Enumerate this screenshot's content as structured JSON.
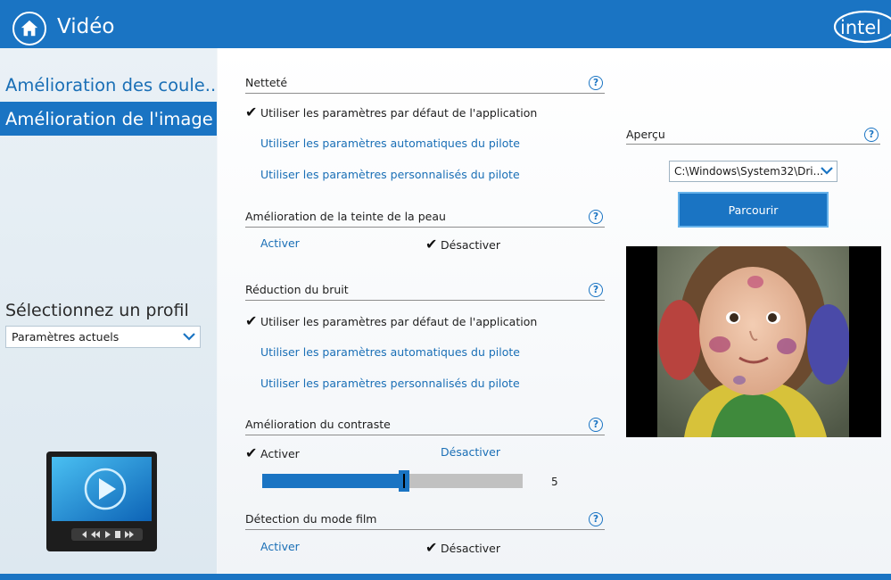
{
  "header": {
    "title": "Vidéo",
    "brand": "intel",
    "accent_color": "#1a74c3"
  },
  "sidebar": {
    "items": [
      {
        "label": "Amélioration des coule...",
        "active": false
      },
      {
        "label": "Amélioration de l'image",
        "active": true
      }
    ],
    "profile_label": "Sélectionnez un profil",
    "profile_value": "Paramètres actuels"
  },
  "sections": {
    "sharpness": {
      "title": "Netteté",
      "options": [
        "Utiliser les paramètres par défaut de l'application",
        "Utiliser les paramètres automatiques du pilote",
        "Utiliser les paramètres personnalisés du pilote"
      ],
      "selected": 0
    },
    "skin_tone": {
      "title": "Amélioration de la teinte de la peau",
      "enable": "Activer",
      "disable": "Désactiver",
      "selected": "disable"
    },
    "noise": {
      "title": "Réduction du bruit",
      "options": [
        "Utiliser les paramètres par défaut de l'application",
        "Utiliser les paramètres automatiques du pilote",
        "Utiliser les paramètres personnalisés du pilote"
      ],
      "selected": 0
    },
    "contrast": {
      "title": "Amélioration du contraste",
      "enable": "Activer",
      "disable": "Désactiver",
      "selected": "enable",
      "slider_value": "5",
      "slider_fraction": 0.55
    },
    "film_mode": {
      "title": "Détection du mode film",
      "enable": "Activer",
      "disable": "Désactiver",
      "selected": "disable"
    }
  },
  "preview": {
    "title": "Aperçu",
    "file": "C:\\Windows\\System32\\Dri...",
    "browse": "Parcourir"
  },
  "icons": {
    "help": "?"
  }
}
